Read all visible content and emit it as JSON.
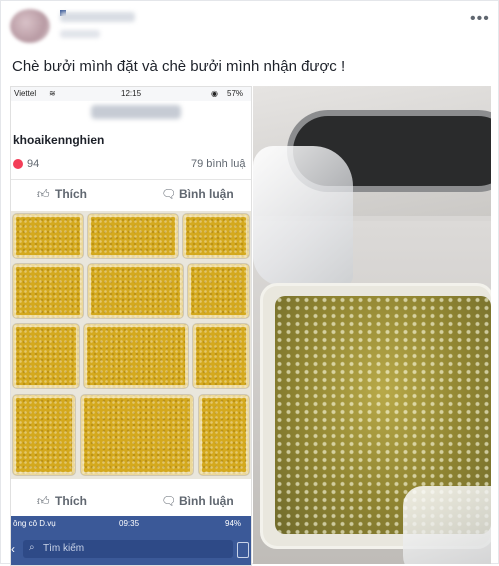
{
  "post": {
    "caption": "Chè bưởi mình đặt và chè bưởi mình nhận được !",
    "more_glyph": "•••"
  },
  "screenshot": {
    "status": {
      "carrier": "Viettel",
      "time": "12:15",
      "battery": "57%"
    },
    "page_name": "khoaikennghien",
    "reaction_count": "94",
    "comment_count": "79 bình luậ",
    "like_label": "Thích",
    "comment_label": "Bình luận",
    "bottom_status": {
      "carrier": "ông cô D.vụ",
      "time": "09:35",
      "battery": "94%"
    },
    "search_placeholder": "Tìm kiếm"
  },
  "colors": {
    "facebook_blue": "#3b5998",
    "reaction_red": "#f33e58",
    "dessert_yellow": "#d4a91e"
  }
}
